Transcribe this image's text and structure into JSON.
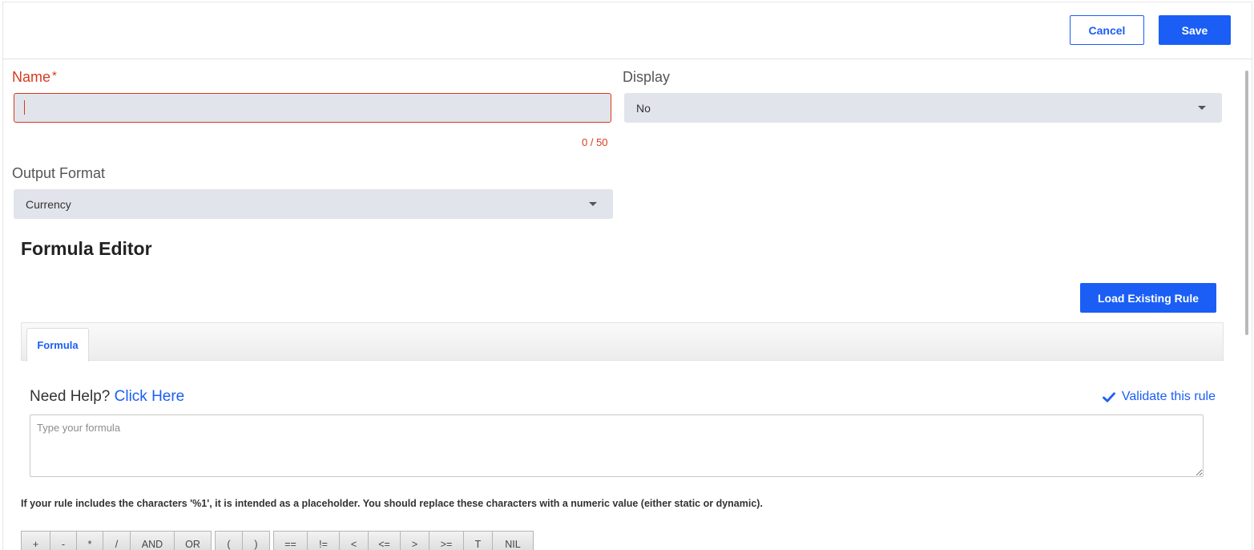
{
  "header": {
    "cancel_label": "Cancel",
    "save_label": "Save"
  },
  "form": {
    "name_label": "Name",
    "name_required_mark": "*",
    "name_value": "",
    "name_counter": "0 / 50",
    "display_label": "Display",
    "display_value": "No",
    "output_format_label": "Output Format",
    "output_format_value": "Currency"
  },
  "editor": {
    "title": "Formula Editor",
    "load_rule_label": "Load Existing Rule",
    "tabs": [
      {
        "label": "Formula",
        "active": true
      }
    ],
    "help_prefix": "Need Help?",
    "help_link": "Click Here",
    "validate_label": "Validate this rule",
    "formula_placeholder": "Type your formula",
    "note": "If your rule includes the characters '%1', it is intended as a placeholder. You should replace these characters with a numeric value (either static or dynamic).",
    "operator_groups": [
      [
        "+",
        "-",
        "*",
        "/",
        "AND",
        "OR"
      ],
      [
        "(",
        ")"
      ],
      [
        "==",
        "!=",
        "<",
        "<=",
        ">",
        ">=",
        "T",
        "NIL"
      ]
    ]
  },
  "colors": {
    "accent": "#1a5ef5",
    "error": "#d63a1f",
    "field_bg": "#e1e4eb"
  }
}
